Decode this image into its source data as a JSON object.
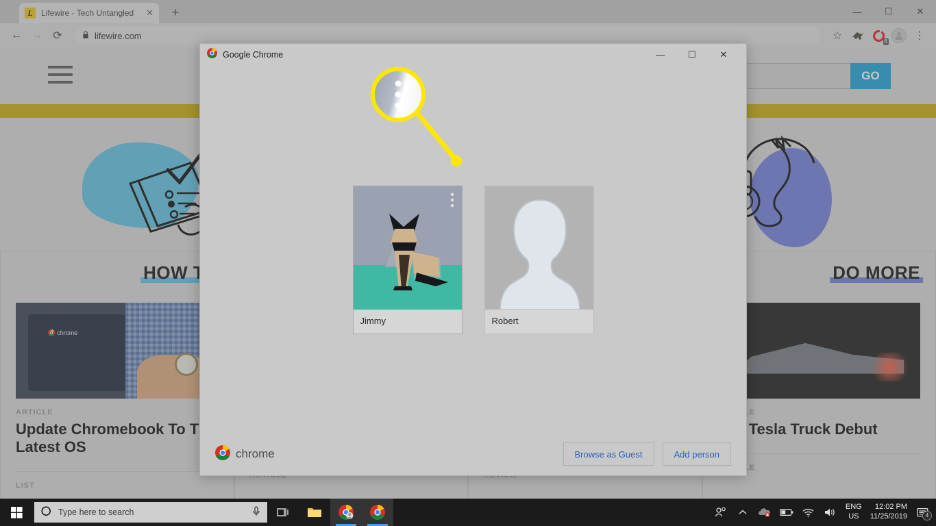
{
  "browser": {
    "tab": {
      "title": "Lifewire - Tech Untangled",
      "favicon_letter": "L",
      "close_icon": "✕"
    },
    "new_tab_icon": "+",
    "window_controls": {
      "minimize": "—",
      "maximize": "☐",
      "close": "✕"
    },
    "nav": {
      "back_icon": "←",
      "forward_icon": "→",
      "reload_icon": "⟳"
    },
    "address": {
      "lock_icon": "🔒",
      "url": "lifewire.com"
    },
    "toolbar_right": {
      "bookmark_icon": "☆",
      "extension_badge_count": "6",
      "menu_icon": "⋮"
    }
  },
  "page": {
    "search_go_label": "GO",
    "accent_gold": "#b89c10",
    "accent_blue": "#1b97c6",
    "sections": [
      {
        "title": "HOW TO",
        "underline_color": "#5ab4d0",
        "kicker": "ARTICLE",
        "headline": "Update Chromebook To The Latest OS",
        "footer_kicker": "LIST"
      },
      {
        "title": "",
        "underline_color": "#5ab4d0",
        "kicker": "",
        "headline": "",
        "footer_kicker": "ARTICLE"
      },
      {
        "title": "",
        "underline_color": "#6a76cb",
        "kicker": "",
        "headline": "",
        "footer_kicker": "REVIEW"
      },
      {
        "title": "DO MORE",
        "underline_color": "#6a76cb",
        "kicker": "ARTICLE",
        "headline": "The Tesla Truck Debut",
        "footer_kicker": "ARTICLE"
      }
    ]
  },
  "dialog": {
    "title": "Google Chrome",
    "window_controls": {
      "minimize": "—",
      "maximize": "☐",
      "close": "✕"
    },
    "profiles": [
      {
        "name": "Jimmy",
        "avatar": "origami-cat",
        "menu_icon": "⋮",
        "selected": true
      },
      {
        "name": "Robert",
        "avatar": "generic-person",
        "menu_icon": "",
        "selected": false
      }
    ],
    "footer": {
      "wordmark": "chrome",
      "guest_button": "Browse as Guest",
      "add_person_button": "Add person"
    }
  },
  "callout": {
    "ring_color": "#ffe800",
    "magnified_icon": "three-dot-menu"
  },
  "taskbar": {
    "search_placeholder": "Type here to search",
    "language": {
      "line1": "ENG",
      "line2": "US"
    },
    "clock": {
      "time": "12:02 PM",
      "date": "11/25/2019"
    },
    "notification_count": "4"
  }
}
